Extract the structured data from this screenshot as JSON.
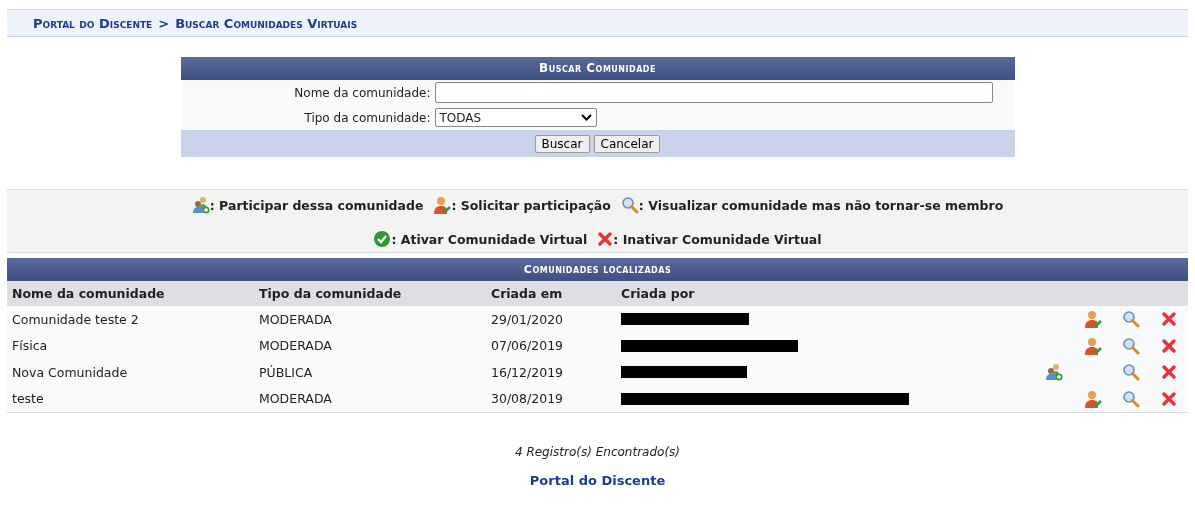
{
  "breadcrumb": {
    "parts": [
      "Portal do Discente",
      "Buscar Comunidades Virtuais"
    ],
    "separator": ">"
  },
  "search_form": {
    "title": "Buscar Comunidade",
    "fields": [
      {
        "kind": "text",
        "label": "Nome da comunidade:"
      },
      {
        "kind": "select",
        "label": "Tipo da comunidade:",
        "value": "TODAS"
      }
    ],
    "buttons": [
      "Buscar",
      "Cancelar"
    ]
  },
  "legend": [
    [
      {
        "kind": "join",
        "text": ": Participar dessa comunidade"
      },
      {
        "kind": "request",
        "text": ": Solicitar participação"
      },
      {
        "kind": "view",
        "text": ": Visualizar comunidade mas não tornar-se membro"
      }
    ],
    [
      {
        "kind": "activate",
        "text": ": Ativar Comunidade Virtual"
      },
      {
        "kind": "deactivate",
        "text": ": Inativar Comunidade Virtual"
      }
    ]
  ],
  "results": {
    "title": "Comunidades localizadas",
    "columns": [
      "Nome da comunidade",
      "Tipo da comunidade",
      "Criada em",
      "Criada por"
    ],
    "rows": [
      {
        "name": "Comunidade teste 2",
        "type": "MODERADA",
        "created_at": "29/01/2020",
        "actions": [
          {
            "kind": "request"
          },
          {
            "kind": "view"
          },
          {
            "kind": "deactivate"
          }
        ]
      },
      {
        "name": "Física",
        "type": "MODERADA",
        "created_at": "07/06/2019",
        "actions": [
          {
            "kind": "request"
          },
          {
            "kind": "view"
          },
          {
            "kind": "deactivate"
          }
        ]
      },
      {
        "name": "Nova Comunidade",
        "type": "PÚBLICA",
        "created_at": "16/12/2019",
        "actions": [
          {
            "kind": "join"
          },
          {
            "kind": "view"
          },
          {
            "kind": "deactivate"
          }
        ]
      },
      {
        "name": "teste",
        "type": "MODERADA",
        "created_at": "30/08/2019",
        "actions": [
          {
            "kind": "request"
          },
          {
            "kind": "view"
          },
          {
            "kind": "deactivate"
          }
        ]
      }
    ],
    "count_text": "4 Registro(s) Encontrado(s)"
  },
  "footer_link": "Portal do Discente"
}
